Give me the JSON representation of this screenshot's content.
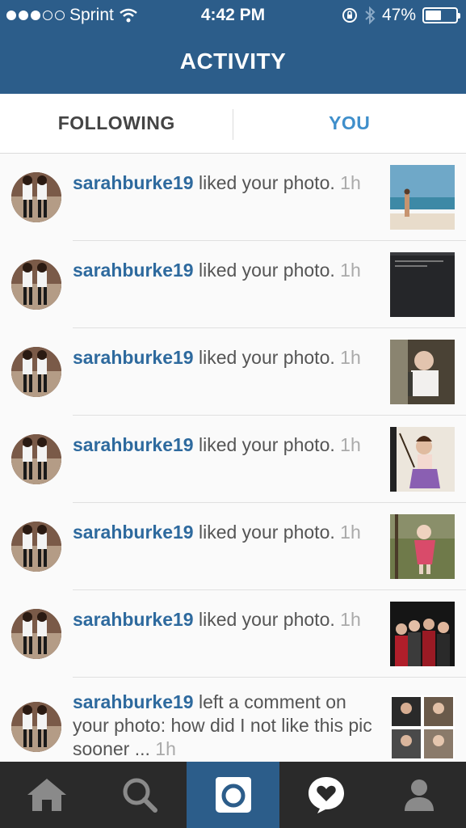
{
  "status_bar": {
    "carrier": "Sprint",
    "signal_bars": 3,
    "time": "4:42 PM",
    "battery": "47%",
    "battery_level": 0.47
  },
  "header": {
    "title": "ACTIVITY"
  },
  "tabs": [
    {
      "label": "FOLLOWING",
      "active": false
    },
    {
      "label": "YOU",
      "active": true
    }
  ],
  "activity": [
    {
      "username": "sarahburke19",
      "action": " liked your photo. ",
      "time": "1h",
      "thumbnail": "beach-photo"
    },
    {
      "username": "sarahburke19",
      "action": " liked your photo. ",
      "time": "1h",
      "thumbnail": "screenshot-photo"
    },
    {
      "username": "sarahburke19",
      "action": " liked your photo. ",
      "time": "1h",
      "thumbnail": "car-photo"
    },
    {
      "username": "sarahburke19",
      "action": " liked your photo. ",
      "time": "1h",
      "thumbnail": "child-costume-photo"
    },
    {
      "username": "sarahburke19",
      "action": " liked your photo. ",
      "time": "1h",
      "thumbnail": "child-outdoor-photo"
    },
    {
      "username": "sarahburke19",
      "action": " liked your photo. ",
      "time": "1h",
      "thumbnail": "group-photo"
    },
    {
      "username": "sarahburke19",
      "action": " left a comment on your photo: how did I not like this pic sooner ... ",
      "time": "1h",
      "thumbnail": "collage-photo"
    }
  ],
  "bottom_nav": [
    {
      "icon": "home-icon",
      "active": false
    },
    {
      "icon": "search-icon",
      "active": false
    },
    {
      "icon": "camera-icon",
      "active": true
    },
    {
      "icon": "activity-heart-icon",
      "active": false
    },
    {
      "icon": "profile-icon",
      "active": false
    }
  ],
  "colors": {
    "header": "#2c5d8a",
    "username": "#2e6a9e",
    "active_tab": "#3f8fcb",
    "bottom_bar": "#2a2a2a"
  }
}
